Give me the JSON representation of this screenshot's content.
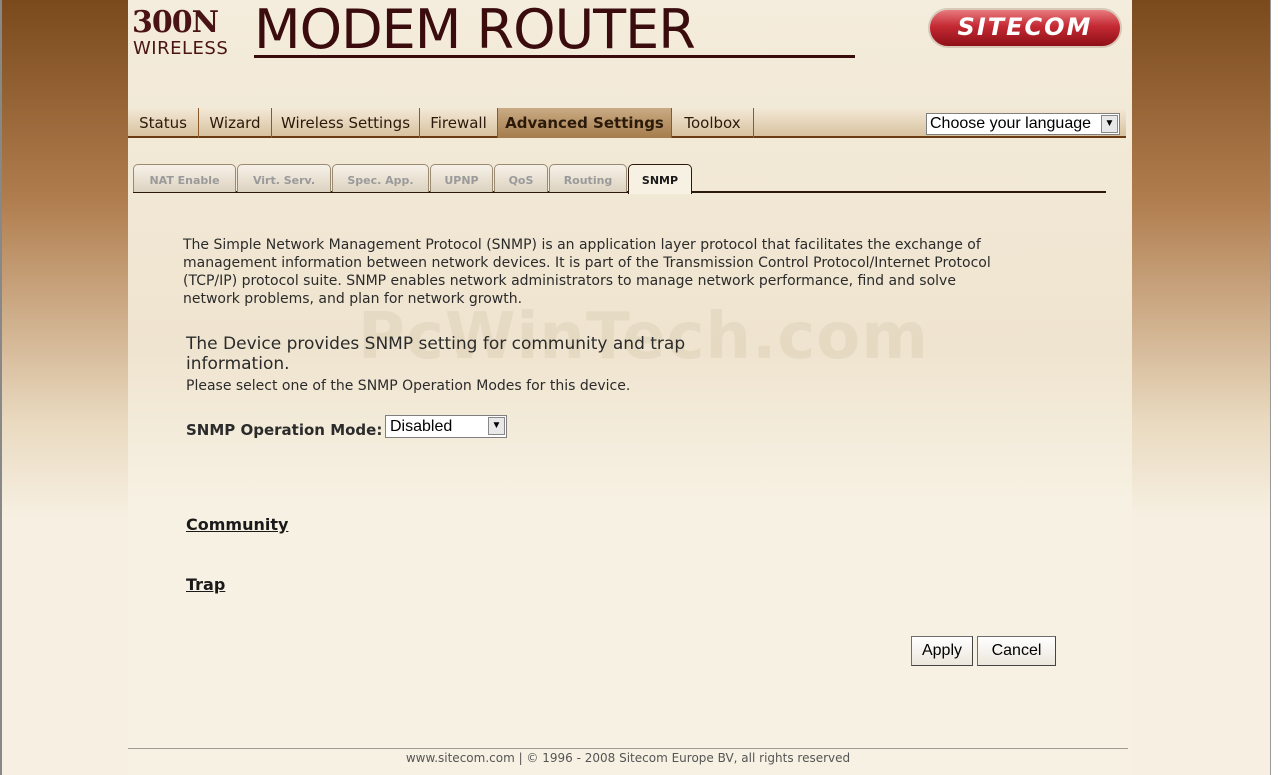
{
  "header": {
    "logo_model": "300N",
    "logo_wireless": "WIRELESS",
    "logo_title": "MODEM ROUTER",
    "brand": "SITECOM"
  },
  "nav": {
    "items": [
      {
        "label": "Status"
      },
      {
        "label": "Wizard"
      },
      {
        "label": "Wireless Settings"
      },
      {
        "label": "Firewall"
      },
      {
        "label": "Advanced Settings"
      },
      {
        "label": "Toolbox"
      }
    ],
    "active": "Advanced Settings",
    "language_select": "Choose your language"
  },
  "subtabs": {
    "items": [
      {
        "label": "NAT Enable"
      },
      {
        "label": "Virt. Serv."
      },
      {
        "label": "Spec. App."
      },
      {
        "label": "UPNP"
      },
      {
        "label": "QoS"
      },
      {
        "label": "Routing"
      },
      {
        "label": "SNMP"
      }
    ],
    "active": "SNMP"
  },
  "content": {
    "description_line1": "The Simple Network Management Protocol (SNMP) is an application layer protocol that facilitates the exchange of",
    "description_line2": "management information between network devices. It is part of the Transmission Control Protocol/Internet Protocol",
    "description_line3": "(TCP/IP) protocol suite. SNMP enables network administrators to manage network performance, find and solve",
    "description_line4": "network problems, and plan for network growth.",
    "watermark": "PcWinTech.com",
    "device_line1": "The Device provides SNMP setting for community and trap",
    "device_line2": "information.",
    "select_hint": "Please select one of the SNMP Operation Modes for this device.",
    "mode_label": "SNMP Operation Mode:",
    "mode_value": "Disabled",
    "community_link": "Community",
    "trap_link": "Trap",
    "apply_label": "Apply",
    "cancel_label": "Cancel"
  },
  "footer": {
    "text": "www.sitecom.com | © 1996 - 2008 Sitecom Europe BV, all rights reserved"
  },
  "colors": {
    "brand_red": "#c42a33",
    "title_maroon": "#3a0c0e",
    "nav_active": "#a57c4c",
    "page_bg": "#f7f1e3"
  }
}
